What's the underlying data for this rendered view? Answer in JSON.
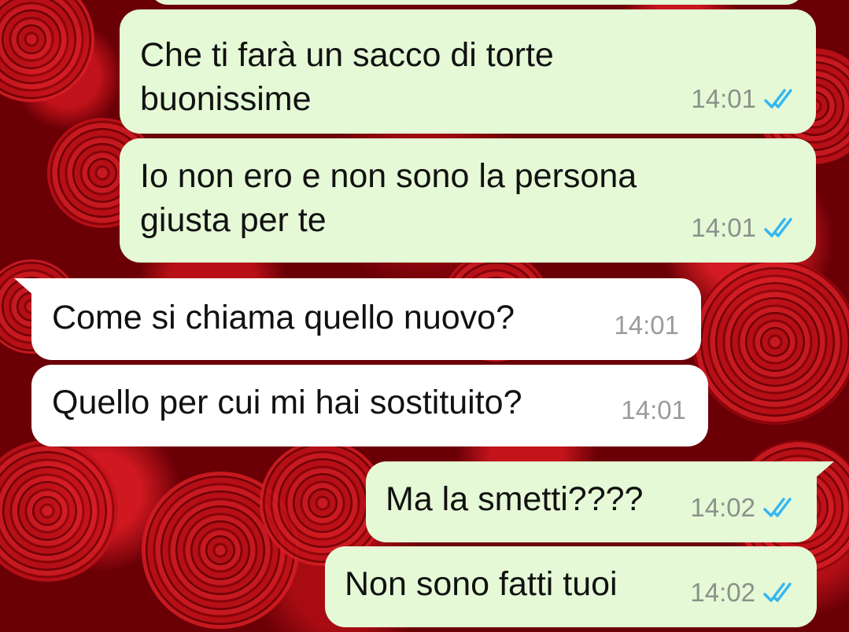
{
  "chat": {
    "messages": [
      {
        "direction": "outgoing",
        "text_lines": [
          "Che ti farà un sacco di torte",
          "buonissime"
        ],
        "time": "14:01",
        "status": "read-double-check-icon"
      },
      {
        "direction": "outgoing",
        "text_lines": [
          "Io non ero e non sono la persona",
          "giusta per te"
        ],
        "time": "14:01",
        "status": "read-double-check-icon"
      },
      {
        "direction": "incoming",
        "text_lines": [
          "Come si chiama quello nuovo?"
        ],
        "time": "14:01"
      },
      {
        "direction": "incoming",
        "text_lines": [
          "Quello per cui mi hai sostituito?"
        ],
        "time": "14:01"
      },
      {
        "direction": "outgoing",
        "text_lines": [
          "Ma la smetti????"
        ],
        "time": "14:02",
        "status": "read-double-check-icon"
      },
      {
        "direction": "outgoing",
        "text_lines": [
          "Non sono fatti tuoi"
        ],
        "time": "14:02",
        "status": "read-double-check-icon"
      }
    ]
  },
  "colors": {
    "outgoing_bubble": "#e5f9d6",
    "incoming_bubble": "#ffffff",
    "read_ticks": "#34b7f1",
    "wallpaper": "red roses"
  }
}
